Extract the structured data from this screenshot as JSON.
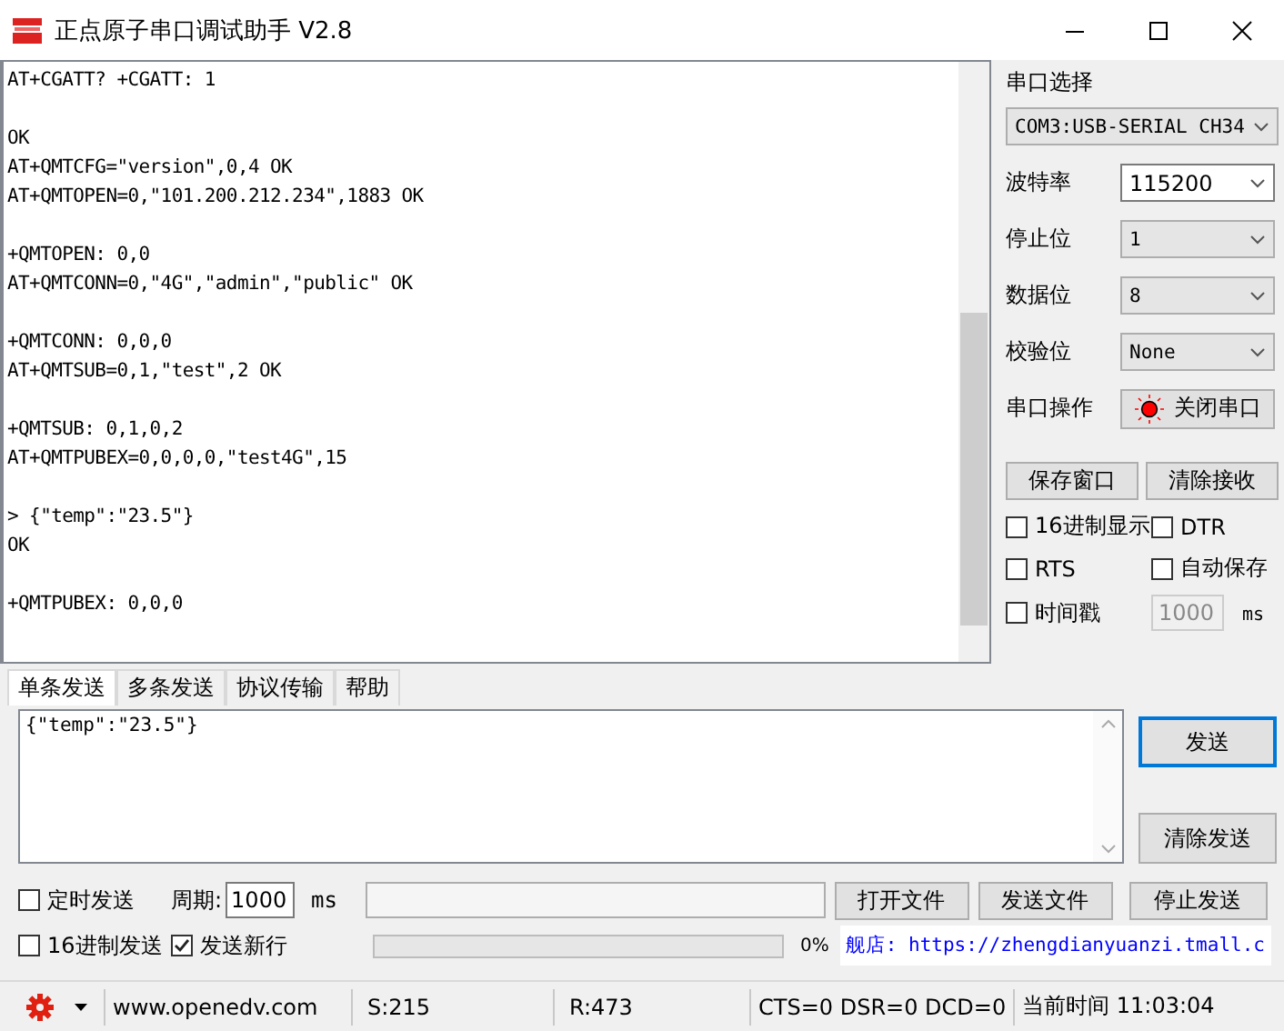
{
  "window": {
    "title": "正点原子串口调试助手 V2.8"
  },
  "receive_log": {
    "blocks": [
      [
        "AT+CGATT? +CGATT: 1"
      ],
      [
        "OK",
        "AT+QMTCFG=\"version\",0,4 OK",
        "AT+QMTOPEN=0,\"101.200.212.234\",1883 OK"
      ],
      [
        "+QMTOPEN: 0,0",
        "AT+QMTCONN=0,\"4G\",\"admin\",\"public\" OK"
      ],
      [
        "+QMTCONN: 0,0,0",
        "AT+QMTSUB=0,1,\"test\",2 OK"
      ],
      [
        "+QMTSUB: 0,1,0,2",
        "AT+QMTPUBEX=0,0,0,0,\"test4G\",15"
      ],
      [
        "> {\"temp\":\"23.5\"}",
        "OK"
      ],
      [
        "+QMTPUBEX: 0,0,0"
      ]
    ]
  },
  "port_panel": {
    "port_label": "串口选择",
    "port": "COM3:USB-SERIAL CH34",
    "settings": [
      {
        "label": "波特率",
        "value": "115200",
        "focused": true
      },
      {
        "label": "停止位",
        "value": "1",
        "focused": false
      },
      {
        "label": "数据位",
        "value": "8",
        "focused": false
      },
      {
        "label": "校验位",
        "value": "None",
        "focused": false
      }
    ],
    "operation_label": "串口操作",
    "toggle_button": {
      "label": "关闭串口",
      "open": true
    },
    "buttons": [
      "保存窗口",
      "清除接收"
    ],
    "options": [
      {
        "label": "16进制显示",
        "checked": false
      },
      {
        "label": "DTR",
        "checked": false
      },
      {
        "label": "RTS",
        "checked": false
      },
      {
        "label": "自动保存",
        "checked": false
      },
      {
        "label": "时间戳",
        "checked": false
      }
    ],
    "timestamp_interval": {
      "value": "1000",
      "disabled": true
    },
    "timestamp_unit": "ms"
  },
  "send_tabs": [
    {
      "label": "单条发送",
      "selected": true
    },
    {
      "label": "多条发送",
      "selected": false
    },
    {
      "label": "协议传输",
      "selected": false
    },
    {
      "label": "帮助",
      "selected": false
    }
  ],
  "send_box": {
    "value": "{\"temp\":\"23.5\"}"
  },
  "send_buttons": [
    {
      "label": "发送",
      "focused": true
    },
    {
      "label": "清除发送",
      "focused": false
    }
  ],
  "timer": {
    "checkbox": {
      "label": "定时发送",
      "checked": false
    },
    "period_label": "周期:",
    "period": "1000",
    "unit": "ms"
  },
  "file_buttons": [
    "打开文件",
    "发送文件",
    "停止发送"
  ],
  "send_options": [
    {
      "label": "16进制发送",
      "checked": false
    },
    {
      "label": "发送新行",
      "checked": true
    }
  ],
  "progress": {
    "level": 0,
    "reading": "0%"
  },
  "store_link": "舰店: https://zhengdianyuanzi.tmall.c",
  "status_bar": {
    "website": "www.openedv.com",
    "sent": "S:215",
    "received": "R:473",
    "lines": "CTS=0 DSR=0 DCD=0",
    "time": "当前时间 11:03:04"
  }
}
